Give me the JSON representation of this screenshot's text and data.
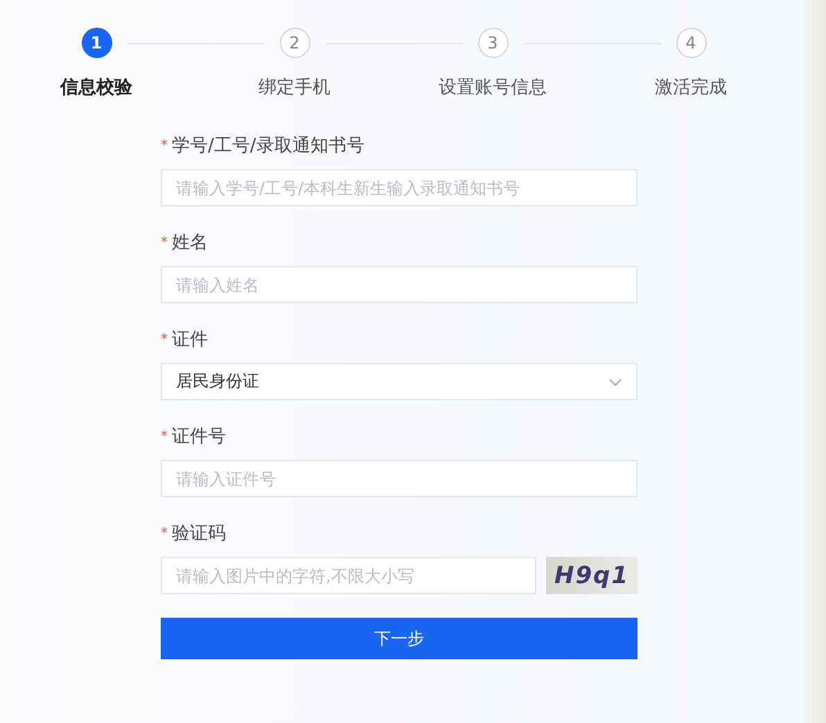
{
  "steps": [
    {
      "number": "1",
      "label": "信息校验",
      "selected": true
    },
    {
      "number": "2",
      "label": "绑定手机",
      "selected": false
    },
    {
      "number": "3",
      "label": "设置账号信息",
      "selected": false
    },
    {
      "number": "4",
      "label": "激活完成",
      "selected": false
    }
  ],
  "fields": [
    {
      "kind": "text",
      "required_mark": "*",
      "label": "学号/工号/录取通知书号",
      "placeholder": "请输入学号/工号/本科生新生输入录取通知书号"
    },
    {
      "kind": "text",
      "required_mark": "*",
      "label": "姓名",
      "placeholder": "请输入姓名"
    },
    {
      "kind": "select",
      "required_mark": "*",
      "label": "证件",
      "value": "居民身份证"
    },
    {
      "kind": "text",
      "required_mark": "*",
      "label": "证件号",
      "placeholder": "请输入证件号"
    },
    {
      "kind": "captcha",
      "required_mark": "*",
      "label": "验证码",
      "placeholder": "请输入图片中的字符,不限大小写",
      "captcha": "H9q1"
    }
  ],
  "submit": {
    "label": "下一步"
  }
}
